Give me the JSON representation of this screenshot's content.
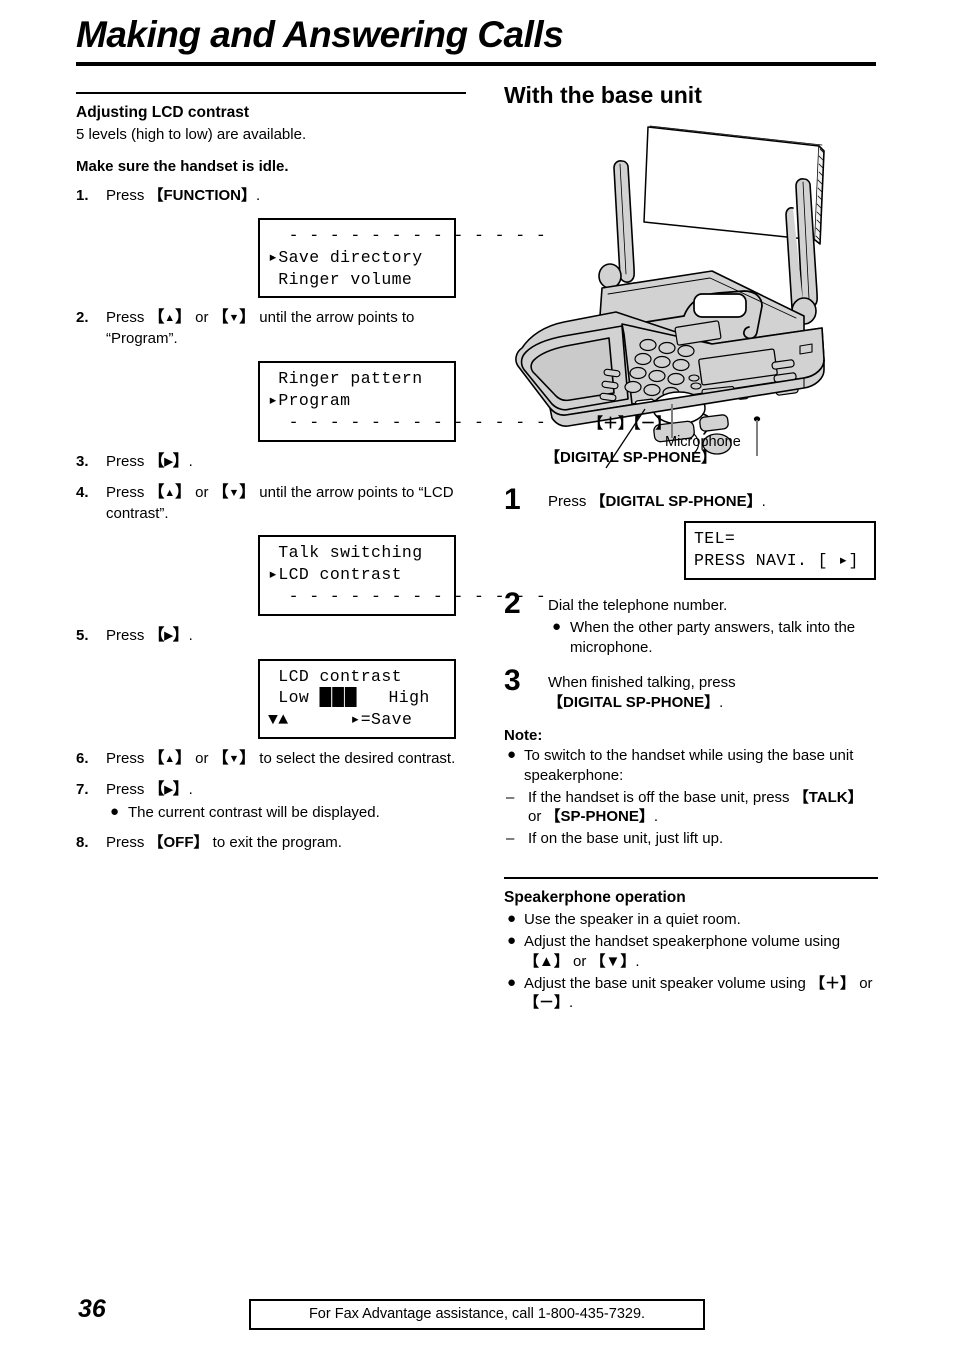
{
  "page": {
    "title": "Making and Answering Calls",
    "number": "36",
    "footer_note": "For Fax Advantage assistance, call 1-800-435-7329."
  },
  "left_column": {
    "heading": "Adjusting LCD contrast",
    "intro": "5 levels (high to low) are available.",
    "precondition": "Make sure the handset is idle.",
    "steps": [
      {
        "num": "1.",
        "text_parts": [
          "Press ",
          "【FUNCTION】",
          "."
        ]
      },
      {
        "num": "2.",
        "text": "Press 【▲】 or 【▼】 until the arrow points to “Program”."
      },
      {
        "num": "3.",
        "text": "Press 【▶】."
      },
      {
        "num": "4.",
        "text": "Press 【▲】 or 【▼】 until the arrow points to “LCD contrast”."
      },
      {
        "num": "5.",
        "text": "Press 【▶】."
      },
      {
        "num": "6.",
        "text": "Press 【▲】 or 【▼】 to select the desired contrast."
      },
      {
        "num": "7.",
        "text": "Press 【▶】."
      },
      {
        "num": "8.",
        "text": "Press 【OFF】 to exit the program."
      }
    ],
    "step7_bullet": "The current contrast will be displayed.",
    "lcd_1": {
      "line1": "  - - - - - - - - - - - - -",
      "line2": "▸Save directory",
      "line3": " Ringer volume"
    },
    "lcd_2": {
      "line1": " Ringer pattern",
      "line2": "▸Program",
      "line3": "  - - - - - - - - - - - - -"
    },
    "lcd_3": {
      "line1": " Talk switching",
      "line2": "▸LCD contrast",
      "line3": "  - - - - - - - - - - - - -"
    },
    "lcd_4": {
      "line1": " LCD contrast",
      "line2_a": " Low ",
      "line2_bar": "███",
      "line2_b": "   High",
      "line3_a": "▼▲",
      "line3_b": "      ▸=Save"
    }
  },
  "right_column": {
    "heading": "With the base unit",
    "illustration": {
      "label_plus_minus": "【＋】【－】",
      "label_microphone": "Microphone",
      "label_digital_sp_phone": "【DIGITAL SP-PHONE】",
      "body_color": "#d2d2d2",
      "outline_color": "#000000"
    },
    "steps": [
      {
        "num": "1",
        "pre": "Press ",
        "key": "【DIGITAL SP-PHONE】",
        "post": "."
      },
      {
        "num": "2",
        "text": "Dial the telephone number.",
        "bullet": "When the other party answers, talk into the microphone."
      },
      {
        "num": "3",
        "pre": "When finished talking, press ",
        "key": "【DIGITAL SP-PHONE】",
        "post": "."
      }
    ],
    "lcd_tel": {
      "line1": "TEL=",
      "line2": "PRESS NAVI. [ ▸]"
    },
    "note": {
      "heading": "Note:",
      "bullet": "To switch to the handset while using the base unit speakerphone:",
      "dashes": [
        {
          "pre": "If the handset is off the base unit, press ",
          "key1": "【TALK】",
          "mid": " or ",
          "key2": "【SP-PHONE】",
          "post": "."
        },
        {
          "text": "If on the base unit, just lift up."
        }
      ]
    },
    "speakerphone": {
      "heading": "Speakerphone operation",
      "bullets": [
        {
          "text": "Use the speaker in a quiet room."
        },
        {
          "pre": "Adjust the handset speakerphone volume using ",
          "key1": "【▲】",
          "mid": " or ",
          "key2": "【▼】",
          "post": "."
        },
        {
          "pre": "Adjust the base unit speaker volume using ",
          "key1": "【＋】",
          "mid": " or ",
          "key2": "【－】",
          "post": "."
        }
      ]
    }
  }
}
